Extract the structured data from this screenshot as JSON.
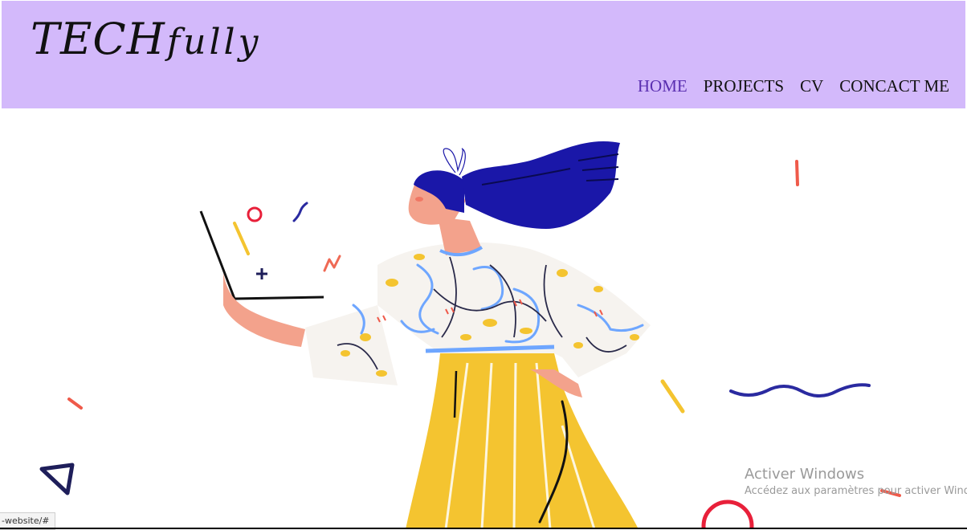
{
  "brand": {
    "part1": "TECH",
    "part2": "fully"
  },
  "nav": {
    "home": "HOME",
    "projects": "PROJECTS",
    "cv": "CV",
    "contact": "CONCACT ME"
  },
  "watermark": {
    "title": "Activer Windows",
    "subtitle": "Accédez aux paramètres pour activer Windows."
  },
  "status_url": "-website/#",
  "colors": {
    "header_bg": "#d3b9fb",
    "nav_active": "#5a2fb0",
    "hair": "#1a17a8",
    "pants": "#f4c430",
    "accent_red": "#e8203a",
    "accent_navy": "#1e1e7a"
  }
}
